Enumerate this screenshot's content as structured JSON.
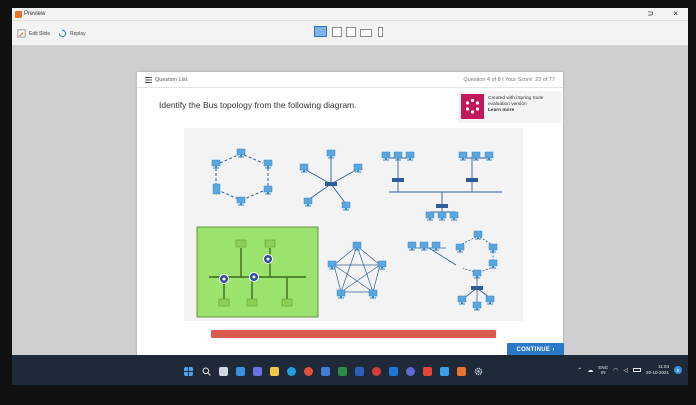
{
  "window": {
    "title": "Preview",
    "controls": {
      "minimize": "-",
      "restore": "⊃",
      "close": "×"
    }
  },
  "toolbar": {
    "edit_slide_label": "Edit Slide",
    "replay_label": "Replay"
  },
  "player": {
    "question_list_label": "Question List",
    "question_meta": "Question 4 of 8   |   Your Score: 23 of 77",
    "question_text": "Identify the Bus topology from the following diagram.",
    "badge": {
      "line1": "Created with iSpring Suite",
      "line2": "evaluation version",
      "line3": "Learn more"
    },
    "continue_label": "CONTINUE  ›"
  },
  "tray": {
    "lang_top": "ENG",
    "lang_bottom": "IN",
    "time": "11:04",
    "date": "20-10-2021",
    "notifications": "8"
  },
  "colors": {
    "accent": "#2a78c8",
    "progress": "#d9594c",
    "selected_bg": "#9be36d",
    "node": "#5aa7e0"
  }
}
